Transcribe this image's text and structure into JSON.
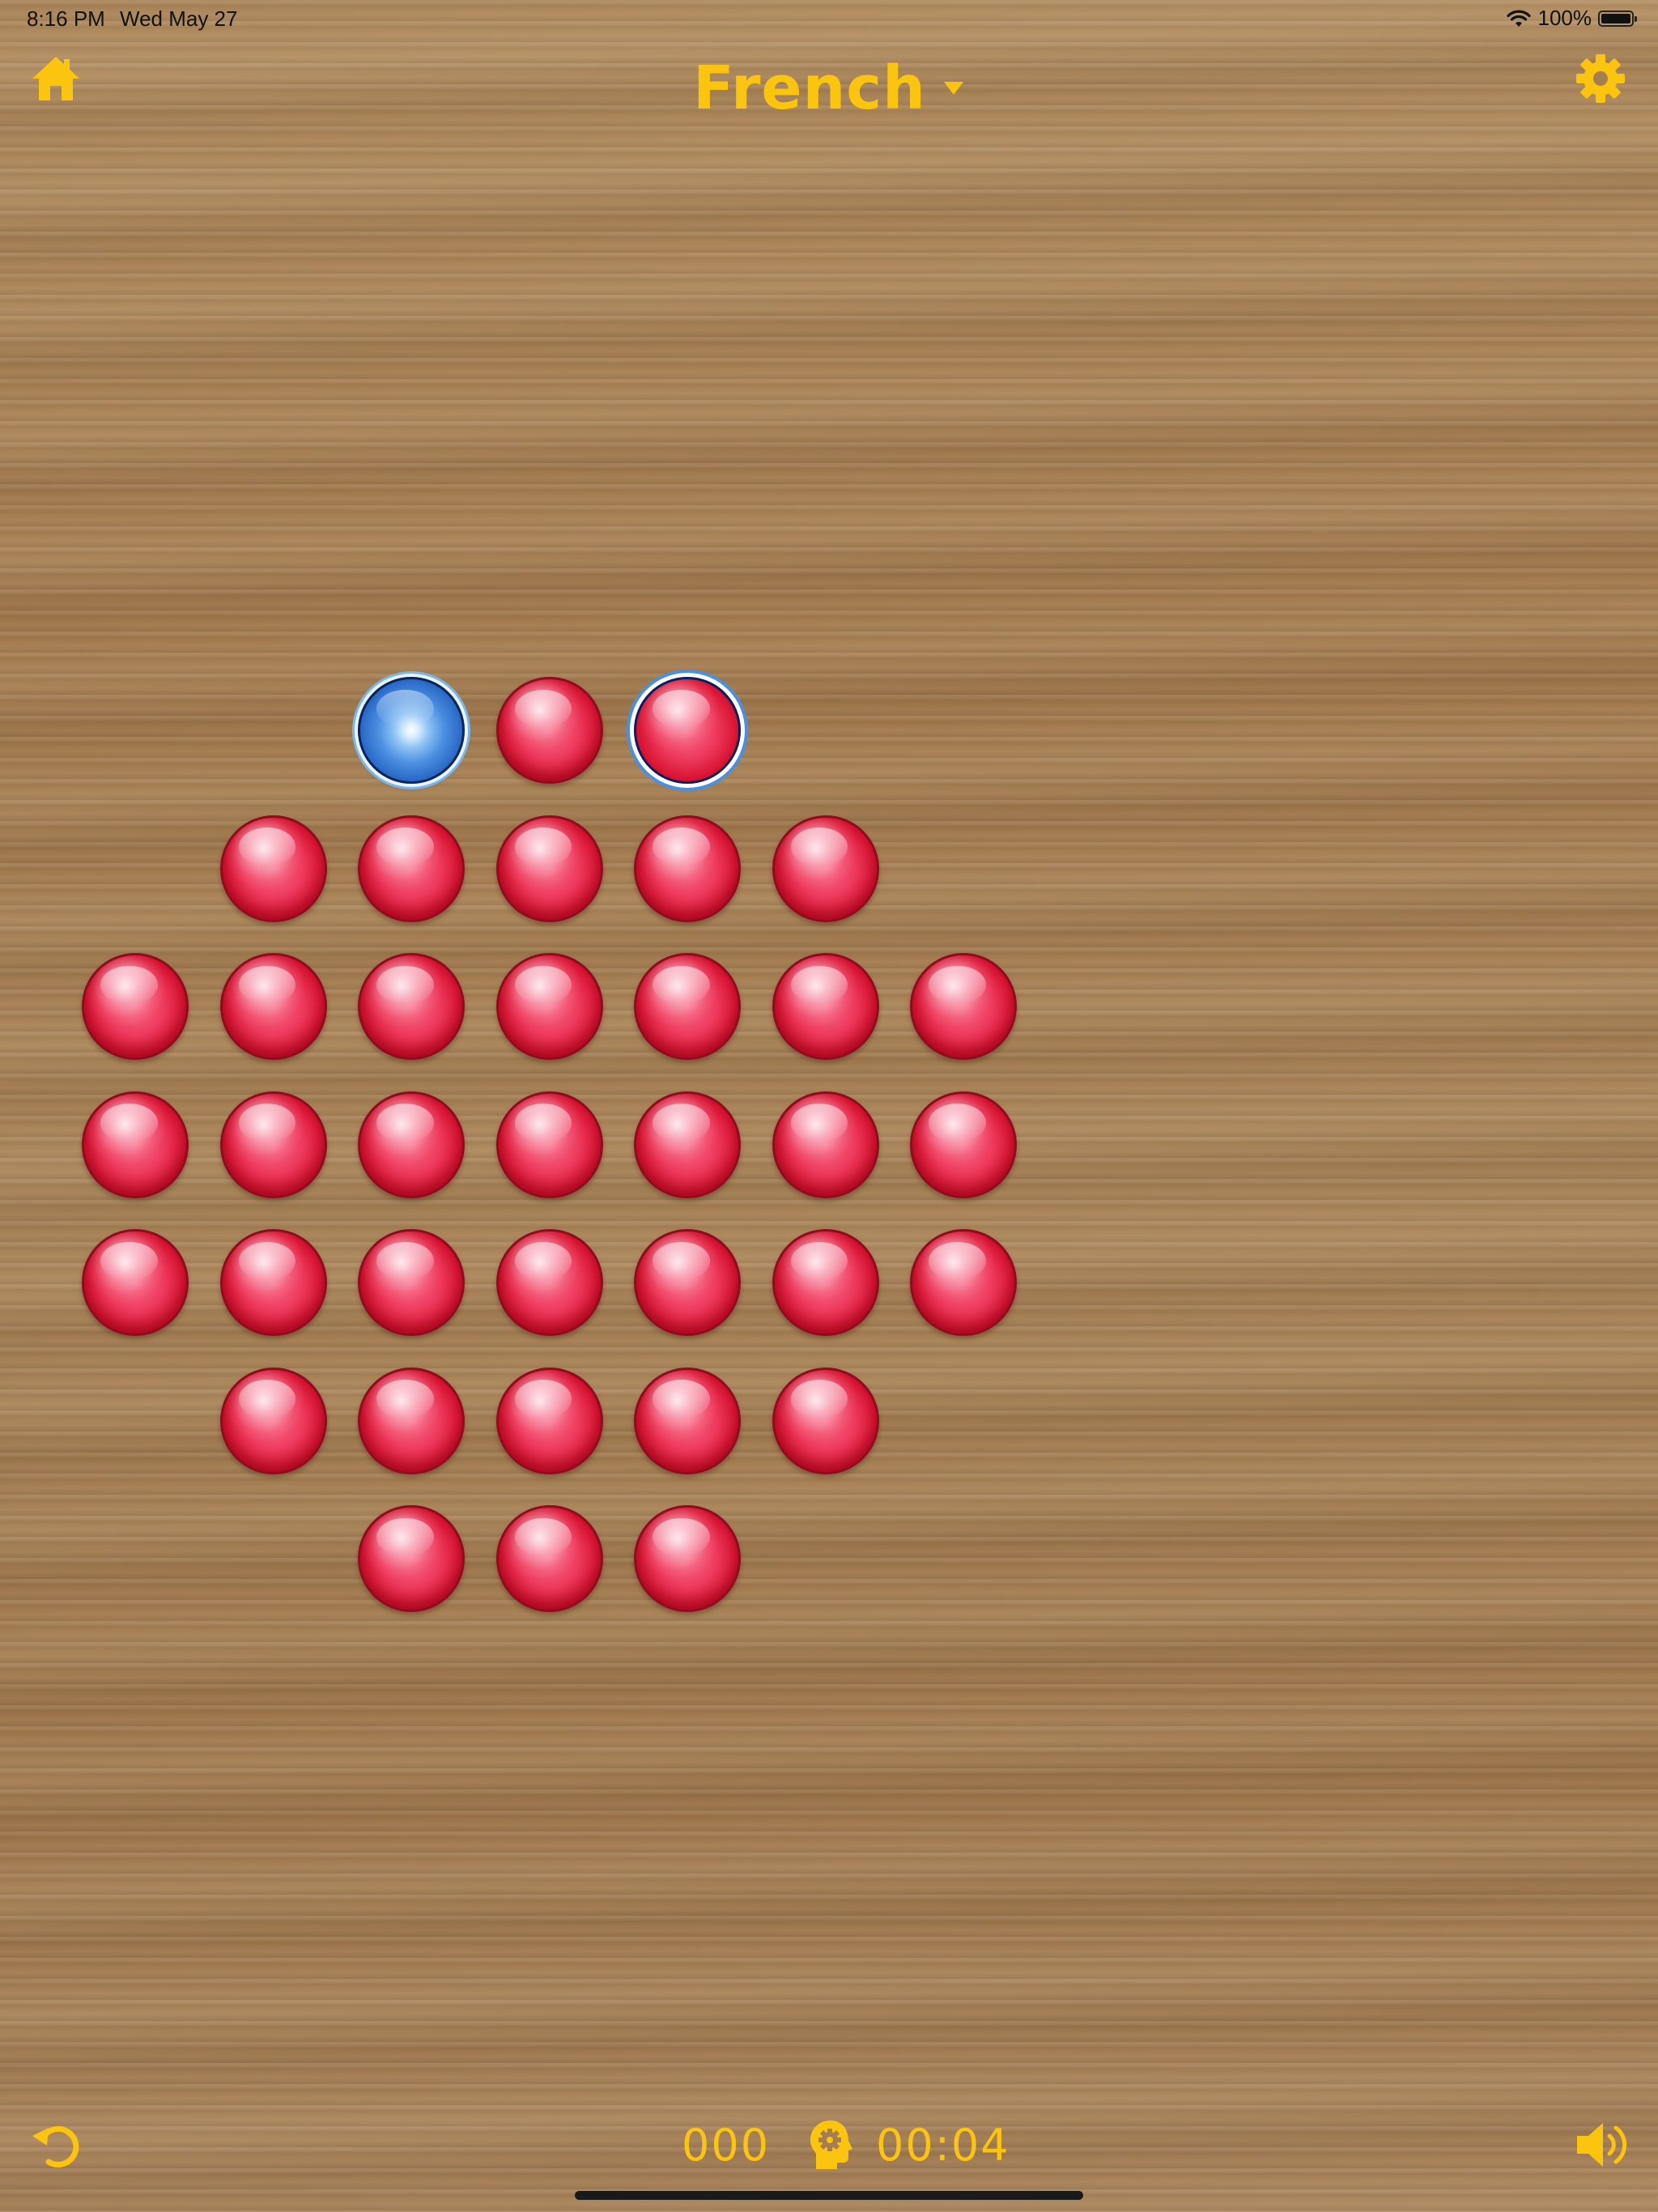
{
  "status_bar": {
    "time": "8:16 PM",
    "date": "Wed May 27",
    "battery": "100%",
    "battery_level": 1.0
  },
  "header": {
    "title": "French",
    "home_icon": "home-icon",
    "settings_icon": "gear-icon",
    "dropdown_icon": "caret-down-icon"
  },
  "board": {
    "layout": "french-solitaire",
    "rows": [
      [
        2,
        3,
        4
      ],
      [
        1,
        2,
        3,
        4,
        5
      ],
      [
        0,
        1,
        2,
        3,
        4,
        5,
        6
      ],
      [
        0,
        1,
        2,
        3,
        4,
        5,
        6
      ],
      [
        0,
        1,
        2,
        3,
        4,
        5,
        6
      ],
      [
        1,
        2,
        3,
        4,
        5
      ],
      [
        2,
        3,
        4
      ]
    ],
    "blue_peg": [
      0,
      2
    ],
    "selected_peg": [
      0,
      4
    ],
    "peg_color": "#e41c3f",
    "highlight_color": "#4a90e2"
  },
  "footer": {
    "moves": "000",
    "timer": "00:04",
    "undo_icon": "undo-icon",
    "hint_icon": "hint-head-icon",
    "sound_icon": "speaker-icon"
  },
  "accent_color": "#fbc40e"
}
